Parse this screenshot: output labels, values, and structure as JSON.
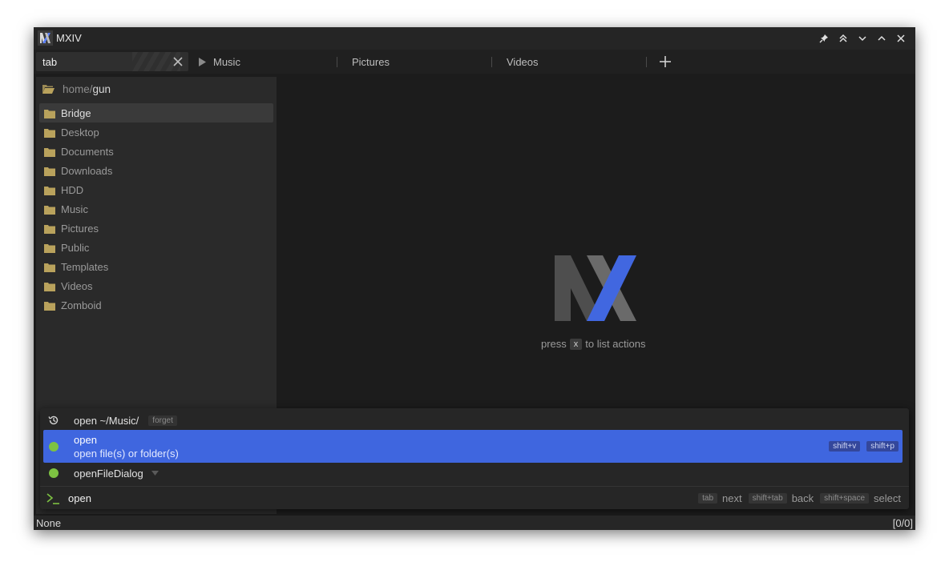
{
  "app": {
    "title": "MXIV"
  },
  "search": {
    "value": "tab"
  },
  "tabs": [
    {
      "label": "Music",
      "playing": true
    },
    {
      "label": "Pictures"
    },
    {
      "label": "Videos"
    }
  ],
  "sidebar": {
    "path_prefix": "home/",
    "path_current": "gun",
    "folders": [
      "Bridge",
      "Desktop",
      "Documents",
      "Downloads",
      "HDD",
      "Music",
      "Pictures",
      "Public",
      "Templates",
      "Videos",
      "Zomboid"
    ],
    "active_index": 0
  },
  "center": {
    "hint_before": "press",
    "hint_key": "x",
    "hint_after": "to list actions"
  },
  "palette": {
    "history": {
      "label": "open ~/Music/",
      "tag": "forget"
    },
    "selected": {
      "title": "open",
      "subtitle": "open file(s) or folder(s)",
      "shortcuts": [
        "shift+v",
        "shift+p"
      ]
    },
    "third": {
      "label": "openFileDialog"
    },
    "prompt": {
      "input": "open",
      "hints": [
        {
          "key": "tab",
          "label": "next"
        },
        {
          "key": "shift+tab",
          "label": "back"
        },
        {
          "key": "shift+space",
          "label": "select"
        }
      ]
    }
  },
  "status": {
    "left": "None",
    "right": "[0/0]"
  },
  "colors": {
    "accent": "#3f66df",
    "dot": "#7dc242",
    "folder": "#b9a25c"
  },
  "icons": [
    "app-logo-icon",
    "pin-icon",
    "double-chevron-up-icon",
    "chevron-down-icon",
    "chevron-up-icon",
    "close-icon",
    "clear-icon",
    "play-icon",
    "add-tab-icon",
    "folder-open-icon",
    "folder-icon",
    "history-icon",
    "terminal-prompt-icon"
  ]
}
